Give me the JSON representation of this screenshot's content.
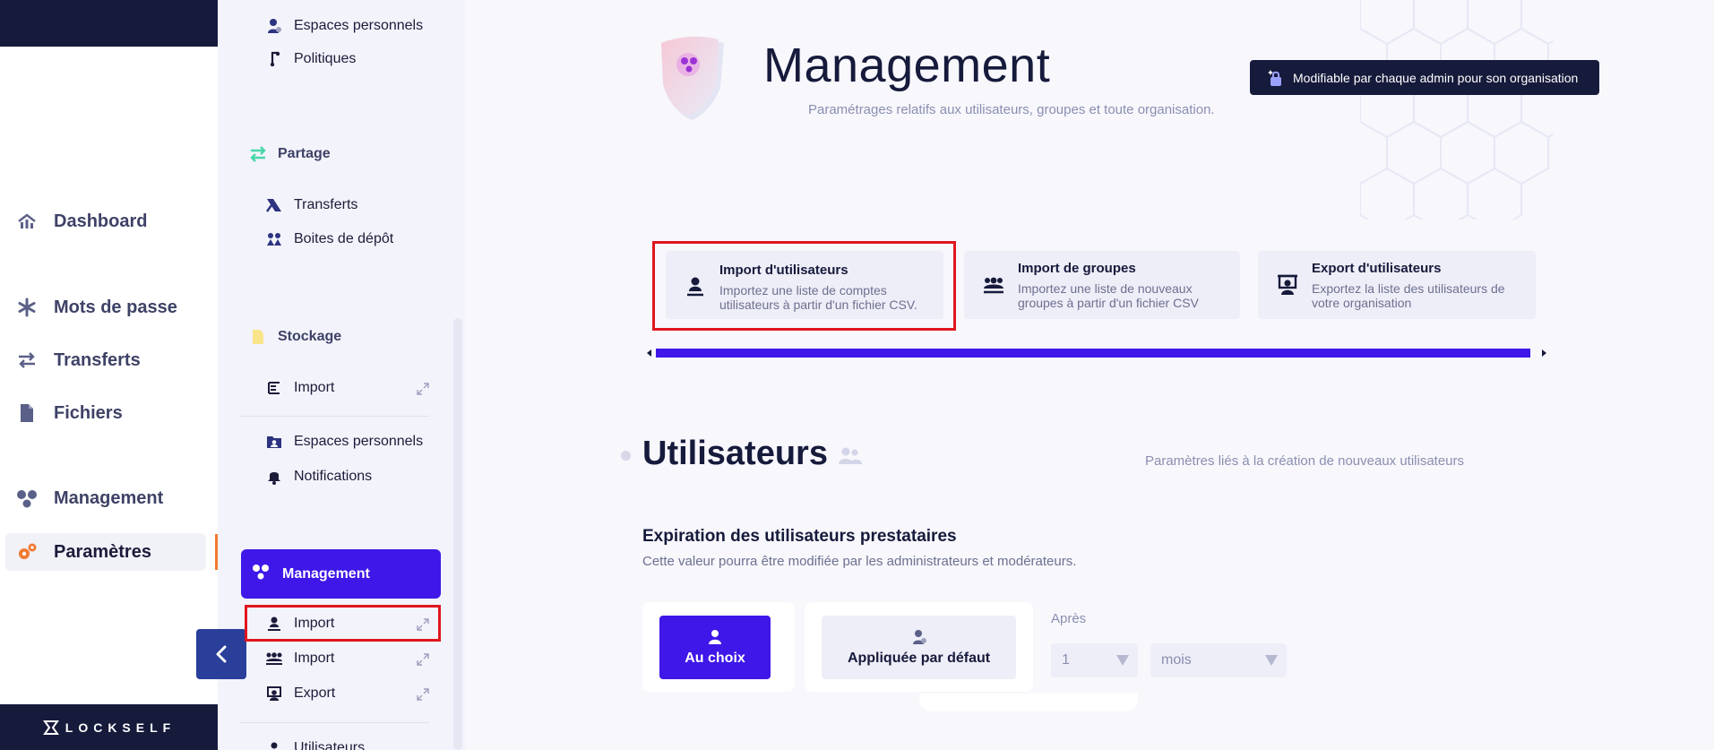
{
  "colors": {
    "accent": "#3f17e8",
    "navy": "#161a3b",
    "highlight": "#e0161e",
    "active_marker": "#f07a32"
  },
  "rail": {
    "items": [
      {
        "label": "Dashboard",
        "icon": "dashboard-icon"
      },
      {
        "label": "Mots de passe",
        "icon": "asterisk-icon"
      },
      {
        "label": "Transferts",
        "icon": "transfer-arrows-icon"
      },
      {
        "label": "Fichiers",
        "icon": "file-icon"
      },
      {
        "label": "Management",
        "icon": "management-dots-icon"
      },
      {
        "label": "Paramètres",
        "icon": "gears-icon"
      }
    ],
    "brand": "LOCKSELF"
  },
  "sidebar": {
    "top_items": [
      {
        "label": "Espaces personnels",
        "icon": "user-space-icon"
      },
      {
        "label": "Politiques",
        "icon": "policy-icon"
      }
    ],
    "sections": {
      "partage": "Partage",
      "stockage": "Stockage",
      "management": "Management"
    },
    "partage_items": [
      {
        "label": "Transferts",
        "icon": "transfer-icon"
      },
      {
        "label": "Boites de dépôt",
        "icon": "dropbox-icon"
      }
    ],
    "stockage_items": [
      {
        "label": "Import",
        "icon": "import-list-icon"
      },
      {
        "label": "Espaces personnels",
        "icon": "folder-user-icon"
      },
      {
        "label": "Notifications",
        "icon": "bell-icon"
      }
    ],
    "management_items": [
      {
        "label": "Import",
        "icon": "import-user-icon"
      },
      {
        "label": "Import",
        "icon": "import-group-icon"
      },
      {
        "label": "Export",
        "icon": "export-user-icon"
      },
      {
        "label": "Utilisateurs",
        "icon": "users-icon"
      }
    ]
  },
  "header": {
    "title": "Management",
    "subtitle": "Paramétrages relatifs aux utilisateurs, groupes et toute organisation.",
    "badge": "Modifiable par chaque admin pour son organisation"
  },
  "cards": [
    {
      "title": "Import d'utilisateurs",
      "desc": "Importez une liste de comptes utilisateurs à partir d'un fichier CSV.",
      "icon": "import-user-icon"
    },
    {
      "title": "Import de groupes",
      "desc": "Importez une liste de nouveaux groupes à partir d'un fichier CSV",
      "icon": "import-group-icon"
    },
    {
      "title": "Export d'utilisateurs",
      "desc": "Exportez la liste des utilisateurs de votre organisation",
      "icon": "export-user-icon"
    }
  ],
  "section": {
    "title": "Utilisateurs",
    "subtitle": "Paramètres liés à la création de nouveaux utilisateurs",
    "setting_title": "Expiration des utilisateurs prestataires",
    "setting_desc": "Cette valeur pourra être modifiée par les administrateurs et modérateurs.",
    "option_choice": "Au choix",
    "option_default": "Appliquée par défaut",
    "after_label": "Après",
    "number_value": "1",
    "unit_value": "mois"
  }
}
